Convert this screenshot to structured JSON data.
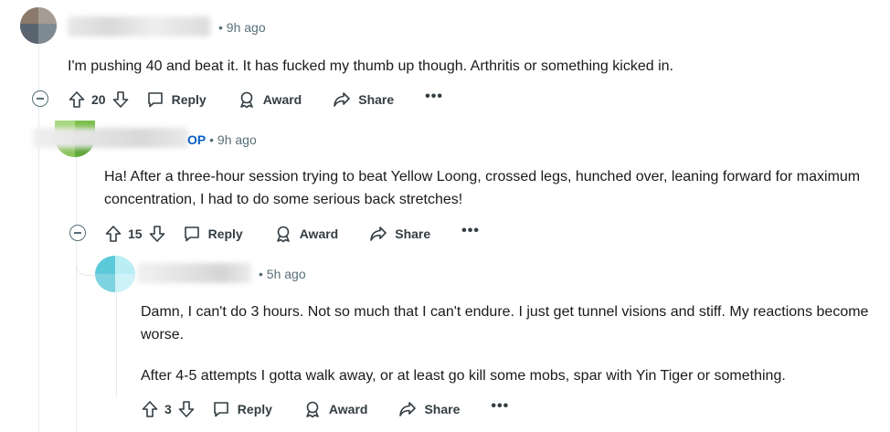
{
  "comments": [
    {
      "time": "• 9h ago",
      "body": "I'm pushing 40 and beat it. It has fucked my thumb up though. Arthritis or something kicked in.",
      "votes": "20",
      "reply_label": "Reply",
      "award_label": "Award",
      "share_label": "Share",
      "more_label": "•••"
    },
    {
      "op_badge": "OP",
      "time": "• 9h ago",
      "body": "Ha! After a three-hour session trying to beat Yellow Loong, crossed legs, hunched over, leaning forward for maximum concentration, I had to do some serious back stretches!",
      "votes": "15",
      "reply_label": "Reply",
      "award_label": "Award",
      "share_label": "Share",
      "more_label": "•••"
    },
    {
      "time": "• 5h ago",
      "body_paragraphs": [
        "Damn, I can't do 3 hours. Not so much that I can't endure. I just get tunnel visions and stiff. My reactions become worse.",
        "After 4-5 attempts I gotta walk away, or at least go kill some mobs, spar with Yin Tiger or something."
      ],
      "votes": "3",
      "reply_label": "Reply",
      "award_label": "Award",
      "share_label": "Share",
      "more_label": "•••"
    }
  ],
  "colors": {
    "op_badge": "#0a5fc4",
    "meta_text": "#576f76",
    "body_text": "#1a1a1b",
    "thread_line": "#e5ebee"
  }
}
